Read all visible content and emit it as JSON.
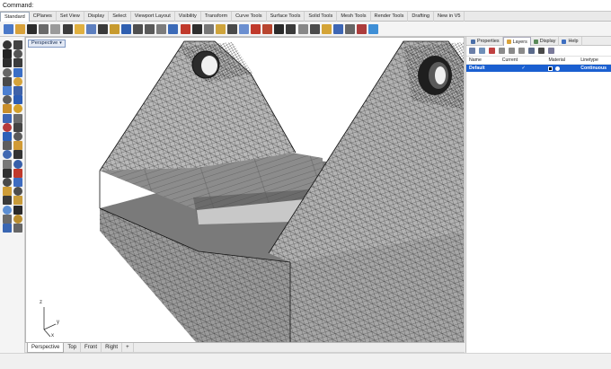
{
  "command": {
    "label": "Command:",
    "value": ""
  },
  "tabs": [
    "Standard",
    "CPlanes",
    "Set View",
    "Display",
    "Select",
    "Viewport Layout",
    "Visibility",
    "Transform",
    "Curve Tools",
    "Surface Tools",
    "Solid Tools",
    "Mesh Tools",
    "Render Tools",
    "Drafting",
    "New in V5"
  ],
  "active_tab": "Standard",
  "viewport": {
    "title": "Perspective",
    "axis_z": "z",
    "axis_y": "y",
    "axis_x": "x"
  },
  "viewport_tabs": [
    "Perspective",
    "Top",
    "Front",
    "Right",
    "+"
  ],
  "panel": {
    "tabs": [
      "Properties",
      "Layers",
      "Display",
      "Help"
    ],
    "active_tab": "Layers",
    "columns": {
      "name": "Name",
      "current": "Current",
      "material": "Material",
      "linetype": "Linetype"
    },
    "layers": [
      {
        "name": "Default",
        "current": "✓",
        "color": "#000000",
        "linetype": "Continuous"
      }
    ]
  }
}
